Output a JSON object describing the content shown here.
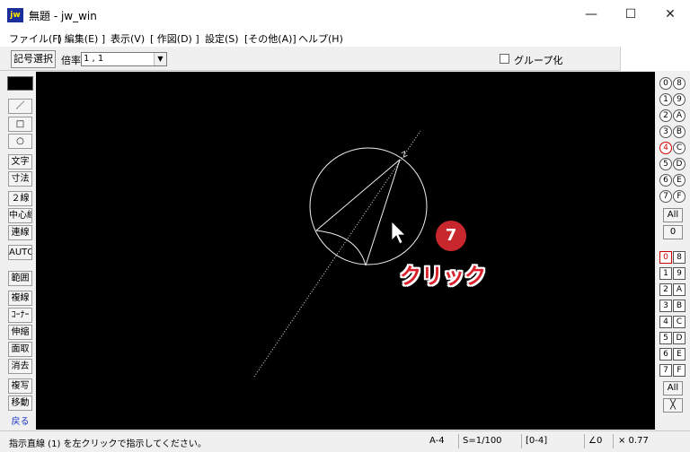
{
  "window": {
    "app_icon_text": "jw",
    "title": "無題 - jw_win",
    "minimize": "—",
    "maximize": "☐",
    "close": "✕"
  },
  "menu": {
    "items": [
      "ファイル(F)",
      "[ 編集(E) ]",
      "表示(V)",
      "[ 作図(D) ]",
      "設定(S)",
      "[その他(A)]",
      "ヘルプ(H)"
    ]
  },
  "toolbar": {
    "symbol_select": "記号選択",
    "scale_label": "倍率",
    "scale_value": "1 , 1",
    "group_checkbox_label": "グループ化",
    "group_checked": false
  },
  "left_tools": {
    "line": "／",
    "rect": "□",
    "circle": "○",
    "text": "文字",
    "dimension": "寸法",
    "double_line": "２線",
    "center_line": "中心線",
    "continuous_line": "連線",
    "auto": "AUTO",
    "range": "範囲",
    "copy_line": "複線",
    "corner": "ｺｰﾅｰ",
    "stretch": "伸縮",
    "chamfer": "面取",
    "erase": "消去",
    "duplicate": "複写",
    "move": "移動",
    "back": "戻る"
  },
  "right_panel": {
    "circle_layers_left": [
      "0",
      "1",
      "2",
      "3",
      "4",
      "5",
      "6",
      "7"
    ],
    "circle_layers_right": [
      "8",
      "9",
      "A",
      "B",
      "C",
      "D",
      "E",
      "F"
    ],
    "active_circle_layer": "4",
    "all_label": "All",
    "zero_label": "0",
    "square_layers_left": [
      "0",
      "1",
      "2",
      "3",
      "4",
      "5",
      "6",
      "7"
    ],
    "square_layers_right": [
      "8",
      "9",
      "A",
      "B",
      "C",
      "D",
      "E",
      "F"
    ],
    "active_square_layer": "0",
    "all_label_2": "All",
    "cross_label": "╳"
  },
  "annotation": {
    "step_number": "7",
    "click_text": "クリック",
    "badge_color": "#c8282d",
    "text_color": "#d9202a"
  },
  "status": {
    "message": "指示直線 (1) を左クリックで指示してください。",
    "paper": "A-4",
    "scale": "S=1/100",
    "layer": "[0-4]",
    "angle": "∠0",
    "factor": "× 0.77"
  }
}
